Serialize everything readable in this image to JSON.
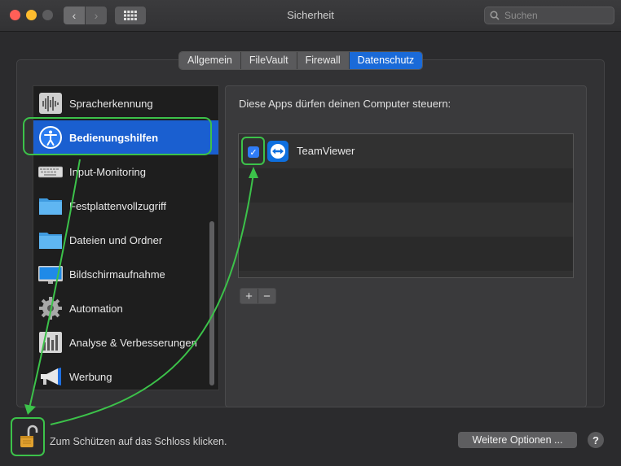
{
  "window": {
    "title": "Sicherheit"
  },
  "search": {
    "placeholder": "Suchen"
  },
  "tabs": [
    {
      "label": "Allgemein",
      "active": false
    },
    {
      "label": "FileVault",
      "active": false
    },
    {
      "label": "Firewall",
      "active": false
    },
    {
      "label": "Datenschutz",
      "active": true
    }
  ],
  "sidebar": {
    "items": [
      {
        "label": "Spracherkennung",
        "icon": "waveform-icon"
      },
      {
        "label": "Bedienungshilfen",
        "icon": "accessibility-icon",
        "selected": true
      },
      {
        "label": "Input-Monitoring",
        "icon": "keyboard-icon"
      },
      {
        "label": "Festplattenvollzugriff",
        "icon": "folder-icon"
      },
      {
        "label": "Dateien und Ordner",
        "icon": "folder-icon"
      },
      {
        "label": "Bildschirmaufnahme",
        "icon": "display-icon"
      },
      {
        "label": "Automation",
        "icon": "gear-icon"
      },
      {
        "label": "Analyse & Verbesserungen",
        "icon": "chart-icon"
      },
      {
        "label": "Werbung",
        "icon": "megaphone-icon"
      }
    ]
  },
  "main": {
    "heading": "Diese Apps dürfen deinen Computer steuern:",
    "apps": [
      {
        "name": "TeamViewer",
        "checked": true,
        "icon": "teamviewer-icon"
      }
    ],
    "add_label": "+",
    "remove_label": "−"
  },
  "footer": {
    "lock_text": "Zum Schützen auf das Schloss klicken.",
    "more_options_label": "Weitere Optionen ...",
    "help_label": "?"
  },
  "colors": {
    "accent": "#1a5fd0",
    "annotation": "#3cc24a"
  }
}
